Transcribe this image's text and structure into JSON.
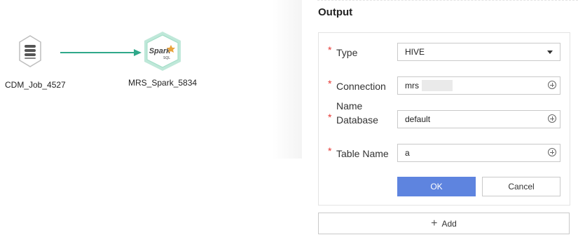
{
  "canvas": {
    "nodes": [
      {
        "label": "CDM_Job_4527",
        "icon": "database-stack-icon"
      },
      {
        "label": "MRS_Spark_5834",
        "icon": "spark-sql-icon",
        "icon_text": "Spark",
        "icon_sub": "SQL"
      }
    ],
    "edge_color": "#2fa88a"
  },
  "panel": {
    "title": "Output",
    "fields": {
      "type": {
        "label": "Type",
        "value": "HIVE"
      },
      "connection": {
        "label": "Connection",
        "value": "mrs"
      },
      "database": {
        "label_line1": "Name",
        "label_line2": "Database",
        "value": "default"
      },
      "table": {
        "label": "Table Name",
        "value": "a"
      }
    },
    "required_mark": "*",
    "ok_label": "OK",
    "cancel_label": "Cancel",
    "add_label": "Add",
    "add_icon": "+"
  },
  "colors": {
    "accent": "#5e84df",
    "required": "#e53935",
    "edge": "#2fa88a"
  }
}
